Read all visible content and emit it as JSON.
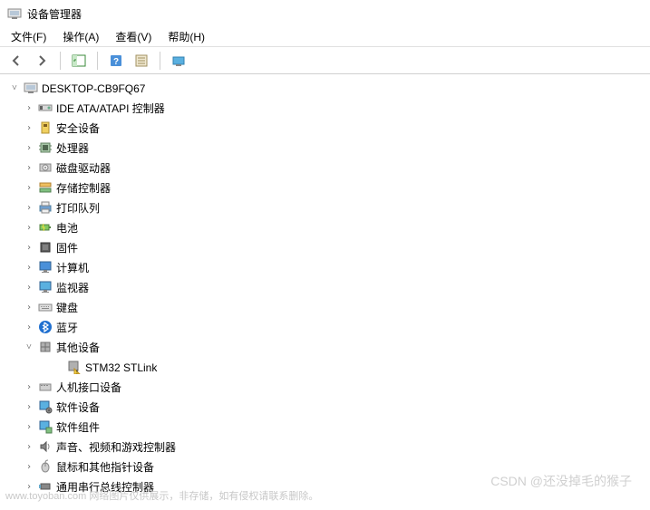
{
  "window": {
    "title": "设备管理器"
  },
  "menu": {
    "file": "文件(F)",
    "action": "操作(A)",
    "view": "查看(V)",
    "help": "帮助(H)"
  },
  "tree": {
    "root": "DESKTOP-CB9FQ67",
    "categories": {
      "ide": "IDE ATA/ATAPI 控制器",
      "security": "安全设备",
      "processor": "处理器",
      "disk": "磁盘驱动器",
      "storage": "存储控制器",
      "print": "打印队列",
      "battery": "电池",
      "firmware": "固件",
      "computer": "计算机",
      "monitor": "监视器",
      "keyboard": "键盘",
      "bluetooth": "蓝牙",
      "other": "其他设备",
      "hid": "人机接口设备",
      "software": "软件设备",
      "component": "软件组件",
      "sound": "声音、视频和游戏控制器",
      "mouse": "鼠标和其他指针设备",
      "usb": "通用串行总线控制器"
    },
    "other_children": {
      "stlink": "STM32 STLink"
    }
  },
  "watermark": {
    "left": "www.toyoban.com 网络图片仅供展示，非存储，如有侵权请联系删除。",
    "right": "CSDN @还没掉毛的猴子"
  }
}
